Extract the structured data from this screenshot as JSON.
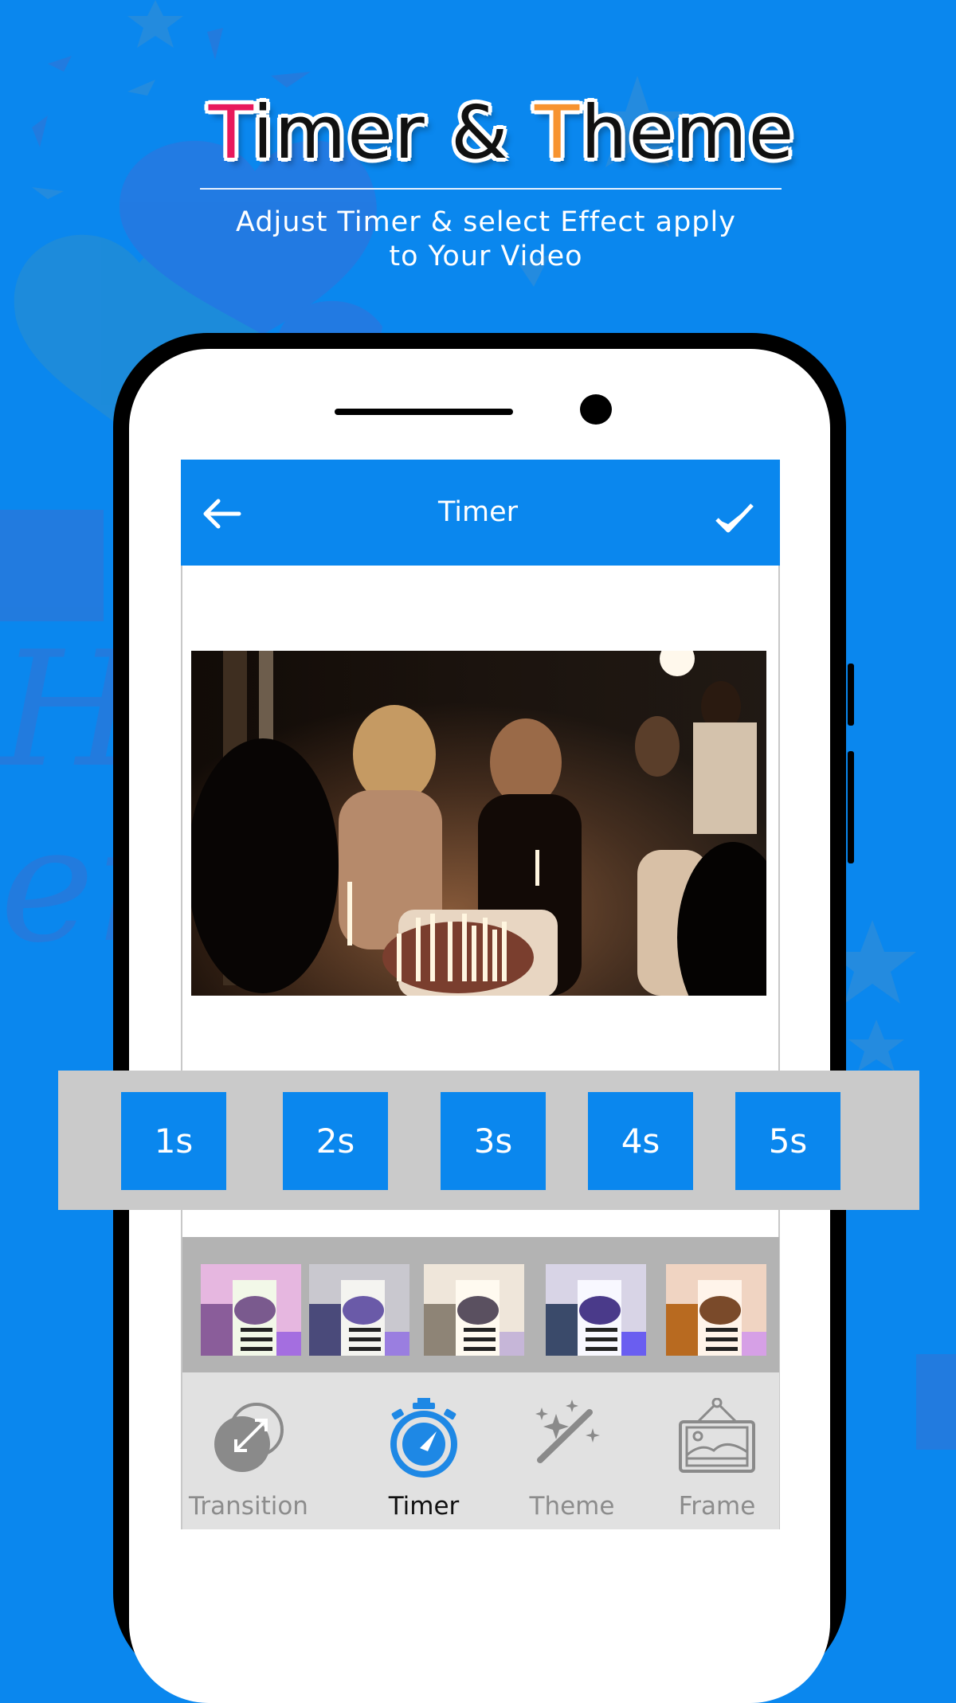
{
  "promo": {
    "title_first_letter": "T",
    "title_part1": "imer & ",
    "title_second_letter": "T",
    "title_part2": "heme",
    "subtitle_line1": "Adjust Timer & select Effect apply",
    "subtitle_line2": "to Your Video",
    "accent_colors": {
      "first_letter": "#e8195c",
      "second_letter": "#f7932f",
      "background": "#0a87ee"
    }
  },
  "app_bar": {
    "title": "Timer",
    "back_icon": "arrow-left-icon",
    "confirm_icon": "checkmark-icon",
    "color": "#0a87ee"
  },
  "preview": {
    "description": "Birthday party photo with candles on cake"
  },
  "timer_options": [
    {
      "label": "1s"
    },
    {
      "label": "2s"
    },
    {
      "label": "3s"
    },
    {
      "label": "4s"
    },
    {
      "label": "5s"
    }
  ],
  "filters": [
    {
      "name": "pink-tint"
    },
    {
      "name": "violet-cool"
    },
    {
      "name": "warm-cream"
    },
    {
      "name": "blue-fade"
    },
    {
      "name": "amber"
    }
  ],
  "bottom_nav": [
    {
      "label": "Transition",
      "icon": "transition-icon",
      "active": false
    },
    {
      "label": "Timer",
      "icon": "stopwatch-icon",
      "active": true
    },
    {
      "label": "Theme",
      "icon": "magic-wand-icon",
      "active": false
    },
    {
      "label": "Frame",
      "icon": "picture-frame-icon",
      "active": false
    }
  ]
}
